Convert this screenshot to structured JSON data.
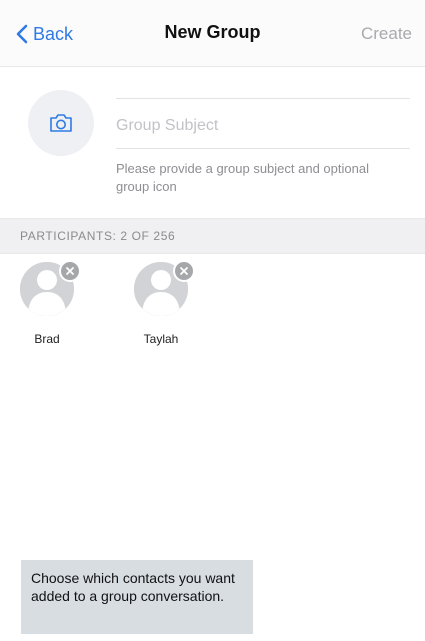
{
  "nav": {
    "back_label": "Back",
    "title": "New Group",
    "create_label": "Create"
  },
  "subject": {
    "placeholder": "Group Subject",
    "value": "",
    "hint": "Please provide a group subject and optional group icon",
    "camera_icon": "camera-icon"
  },
  "participants": {
    "header": "PARTICIPANTS: 2 OF 256",
    "items": [
      {
        "name": "Brad",
        "avatar_icon": "default-avatar-icon",
        "remove_icon": "remove-x-icon"
      },
      {
        "name": "Taylah",
        "avatar_icon": "default-avatar-icon",
        "remove_icon": "remove-x-icon"
      }
    ]
  },
  "caption": {
    "text": "Choose which contacts you want added to a group conversation."
  },
  "colors": {
    "accent": "#2f7ae5",
    "disabled": "#a9a9ae",
    "caption_bg": "#d8dde2"
  }
}
